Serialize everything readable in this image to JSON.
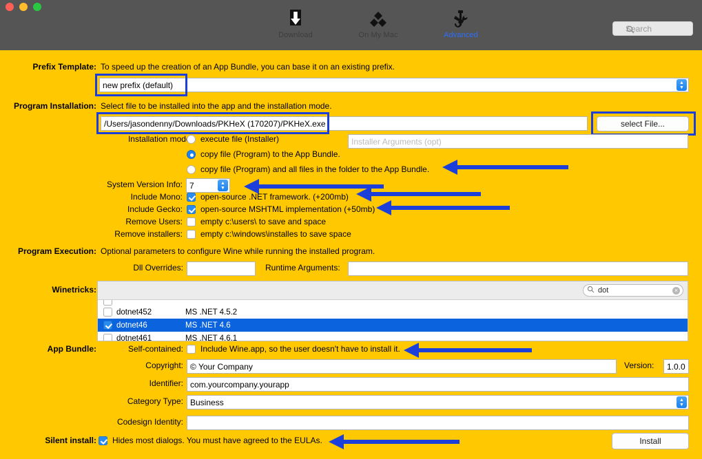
{
  "window": {
    "traffic_lights": [
      "close",
      "minimize",
      "zoom"
    ]
  },
  "toolbar": {
    "items": [
      {
        "label": "Download",
        "icon": "download-icon",
        "active": false
      },
      {
        "label": "On My Mac",
        "icon": "diamonds-icon",
        "active": false
      },
      {
        "label": "Advanced",
        "icon": "wrench-screwdriver-icon",
        "active": true
      }
    ],
    "search_placeholder": "Search"
  },
  "prefix_template": {
    "label": "Prefix Template:",
    "description": "To speed up the creation of an App Bundle, you can base it on an existing prefix.",
    "value": "new prefix (default)"
  },
  "program_installation": {
    "label": "Program Installation:",
    "description": "Select file to be installed into the app and the installation mode.",
    "file_path": "/Users/jasondenny/Downloads/PKHeX (170207)/PKHeX.exe",
    "select_file_button": "select File...",
    "installer_args_placeholder": "Installer Arguments (opt)",
    "installation_mode_label": "Installation mode:",
    "modes": [
      {
        "text": "execute file (Installer)",
        "selected": false
      },
      {
        "text": "copy file (Program)  to the App Bundle.",
        "selected": true
      },
      {
        "text": "copy file (Program)  and all files in the folder to the App Bundle.",
        "selected": false
      }
    ],
    "system_version_label": "System Version Info:",
    "system_version_value": "7",
    "checkboxes": [
      {
        "label": "Include Mono:",
        "text": "open-source .NET framework. (+200mb)",
        "checked": true
      },
      {
        "label": "Include Gecko:",
        "text": "open-source MSHTML implementation (+50mb)",
        "checked": true
      },
      {
        "label": "Remove Users:",
        "text": "empty c:\\users\\ to save and space",
        "checked": false
      },
      {
        "label": "Remove installers:",
        "text": "empty c:\\windows\\installes to save space",
        "checked": false
      }
    ]
  },
  "program_execution": {
    "label": "Program Execution:",
    "description": "Optional parameters to configure Wine while running the installed program.",
    "dll_overrides_label": "Dll Overrides:",
    "dll_overrides_value": "",
    "runtime_arguments_label": "Runtime Arguments:",
    "runtime_arguments_value": ""
  },
  "winetricks": {
    "label": "Winetricks:",
    "search_value": "dot",
    "rows": [
      {
        "name": "dotnet452",
        "desc": "MS .NET 4.5.2",
        "checked": false,
        "selected": false
      },
      {
        "name": "dotnet46",
        "desc": "MS .NET 4.6",
        "checked": true,
        "selected": true
      },
      {
        "name": "dotnet461",
        "desc": "MS .NET 4.6.1",
        "checked": false,
        "selected": false
      }
    ]
  },
  "app_bundle": {
    "label": "App Bundle:",
    "self_contained_label": "Self-contained:",
    "self_contained_text": "Include Wine.app, so the user doesn't have to install it.",
    "self_contained_checked": false,
    "copyright_label": "Copyright:",
    "copyright_value": "© Your Company",
    "version_label": "Version:",
    "version_value": "1.0.0",
    "identifier_label": "Identifier:",
    "identifier_value": "com.yourcompany.yourapp",
    "category_label": "Category Type:",
    "category_value": "Business",
    "codesign_label": "Codesign Identity:",
    "codesign_value": ""
  },
  "silent_install": {
    "label": "Silent install:",
    "text": "Hides most dialogs. You must have agreed to the EULAs.",
    "checked": true,
    "install_button": "Install"
  },
  "colors": {
    "background": "#FFC800",
    "titlebar": "#555555",
    "accent_blue": "#1B3FD8",
    "selection_blue": "#0B63DD",
    "active_tab": "#2C6FFF"
  }
}
